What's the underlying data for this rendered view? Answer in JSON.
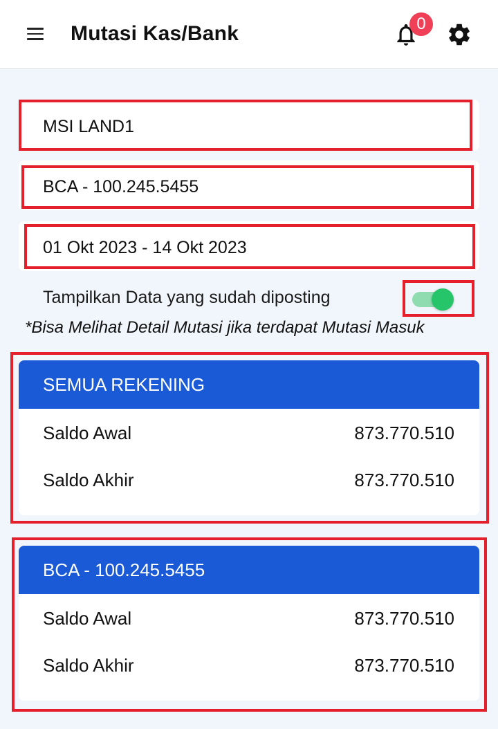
{
  "header": {
    "title": "Mutasi Kas/Bank",
    "notification_count": "0"
  },
  "filters": {
    "company": "MSI LAND1",
    "account": "BCA - 100.245.5455",
    "date_range": "01 Okt 2023 - 14 Okt 2023"
  },
  "toggle": {
    "label": "Tampilkan Data yang sudah diposting",
    "checked": true
  },
  "note": "*Bisa Melihat Detail Mutasi jika terdapat Mutasi Masuk",
  "cards": [
    {
      "title": "SEMUA REKENING",
      "rows": [
        {
          "label": "Saldo Awal",
          "value": "873.770.510"
        },
        {
          "label": "Saldo Akhir",
          "value": "873.770.510"
        }
      ]
    },
    {
      "title": "BCA - 100.245.5455",
      "rows": [
        {
          "label": "Saldo Awal",
          "value": "873.770.510"
        },
        {
          "label": "Saldo Akhir",
          "value": "873.770.510"
        }
      ]
    }
  ],
  "colors": {
    "appbar": "#ffffff",
    "background": "#f0f6fb",
    "card_header": "#1a5ad7",
    "toggle_on": "#26c56a",
    "badge": "#ef4058",
    "highlight": "#e3202b"
  },
  "icons": [
    "menu-icon",
    "bell-icon",
    "gear-icon"
  ]
}
